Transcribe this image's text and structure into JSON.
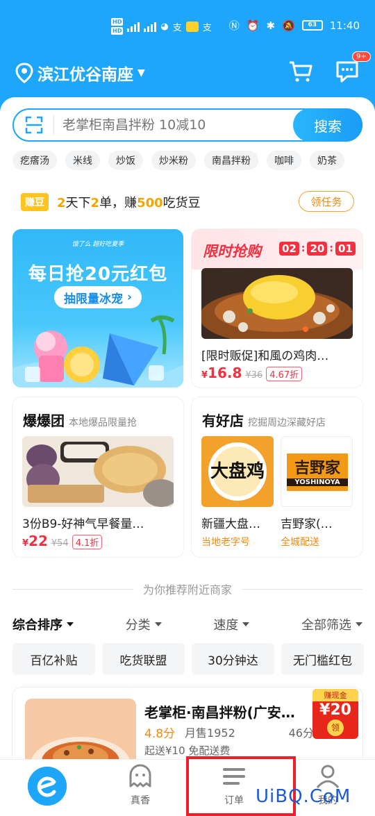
{
  "status_bar": {
    "time": "11:40",
    "battery": "63",
    "network": "4G"
  },
  "header": {
    "location": "滨江优谷南座",
    "message_badge": "9+"
  },
  "search": {
    "placeholder": "老掌柜南昌拌粉 10减10",
    "button": "搜索"
  },
  "chips": [
    "疙瘩汤",
    "米线",
    "炒饭",
    "炒米粉",
    "南昌拌粉",
    "咖啡",
    "奶茶"
  ],
  "beans": {
    "tag": "赚豆",
    "days": "2",
    "text1": "天下",
    "orders": "2",
    "text2": "单，赚",
    "amount": "500",
    "text3": "吃货豆",
    "task_button": "领任务"
  },
  "promo": {
    "small": "饿了么 超好吃夏季",
    "title": "每日抢20元红包",
    "button": "抽限量冰宠"
  },
  "flash_sale": {
    "title": "限时抢购",
    "timer": [
      "02",
      "20",
      "01"
    ],
    "name": "[限时贩促]和風の鸡肉…",
    "price": "16.8",
    "currency": "¥",
    "old_price": "¥36",
    "discount": "4.67折"
  },
  "boom": {
    "title": "爆爆团",
    "subtitle": "本地爆品限量抢",
    "name": "3份B9-好神气早餐量…",
    "price": "22",
    "currency": "¥",
    "old_price": "¥54",
    "discount": "4.1折"
  },
  "good_shops": {
    "title": "有好店",
    "subtitle": "挖掘周边深藏好店",
    "shops": [
      {
        "name": "新疆大盘…",
        "tag": "当地老字号",
        "logo_text": "大盘鸡"
      },
      {
        "name": "吉野家(…",
        "tag": "全城配送",
        "logo_text": "吉野家",
        "logo_sub": "YOSHINOYA"
      }
    ]
  },
  "recommend_divider": "为你推荐附近商家",
  "sort": [
    "综合排序",
    "分类",
    "速度",
    "全部筛选"
  ],
  "filters": [
    "百亿补贴",
    "吃货联盟",
    "30分钟达",
    "无门槛红包"
  ],
  "shop_card": {
    "name": "老掌柜·南昌拌粉(广安…",
    "score": "4.8分",
    "sales": "月售1952",
    "time": "46分钟",
    "delivery": "起送¥10  免配送费",
    "cash_label": "赚现金",
    "cash_amount": "¥20",
    "cash_btn": "领"
  },
  "nav": {
    "tab2": "真香",
    "tab3": "订单",
    "tab4": "我的"
  },
  "watermark": "UiBQ.CoM",
  "colors": {
    "primary": "#1ea6fb",
    "accent_red": "#f23040",
    "accent_orange": "#f08a12"
  }
}
